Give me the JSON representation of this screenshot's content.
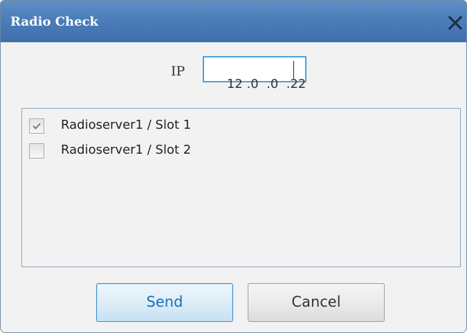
{
  "window": {
    "title": "Radio Check",
    "close_icon": "close-icon"
  },
  "ip": {
    "label": "IP",
    "value": "12 .0  .0  .22"
  },
  "list": {
    "items": [
      {
        "label": "Radioserver1 / Slot 1",
        "checked": true
      },
      {
        "label": "Radioserver1 / Slot 2",
        "checked": false
      }
    ]
  },
  "buttons": {
    "send": "Send",
    "cancel": "Cancel"
  },
  "colors": {
    "titlebar": "#4d7fba",
    "accent": "#1b6fb3",
    "input_border": "#4aa0dc"
  }
}
